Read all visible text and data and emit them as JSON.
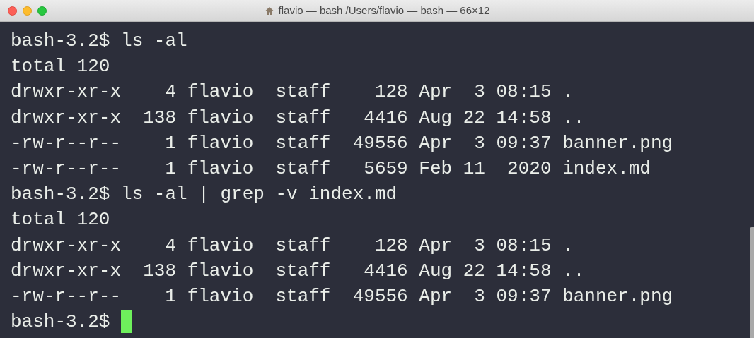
{
  "window": {
    "title": "flavio — bash /Users/flavio — bash — 66×12"
  },
  "terminal": {
    "lines": [
      "bash-3.2$ ls -al",
      "total 120",
      "drwxr-xr-x    4 flavio  staff    128 Apr  3 08:15 .",
      "drwxr-xr-x  138 flavio  staff   4416 Aug 22 14:58 ..",
      "-rw-r--r--    1 flavio  staff  49556 Apr  3 09:37 banner.png",
      "-rw-r--r--    1 flavio  staff   5659 Feb 11  2020 index.md",
      "bash-3.2$ ls -al | grep -v index.md",
      "total 120",
      "drwxr-xr-x    4 flavio  staff    128 Apr  3 08:15 .",
      "drwxr-xr-x  138 flavio  staff   4416 Aug 22 14:58 ..",
      "-rw-r--r--    1 flavio  staff  49556 Apr  3 09:37 banner.png"
    ],
    "prompt": "bash-3.2$"
  }
}
